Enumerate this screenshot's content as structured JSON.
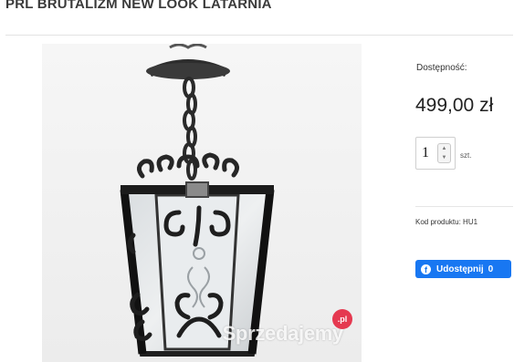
{
  "product": {
    "title": "PRL BRUTALIZM NEW LOOK LATARNIA",
    "image_alt_icon": "lantern-photo"
  },
  "watermark": {
    "text": "Sprzedajemy",
    "badge": ".pl"
  },
  "sidebar": {
    "availability_label": "Dostępność:",
    "price": "499,00 zł",
    "quantity_value": "1",
    "quantity_unit": "szt.",
    "product_code": "Kod produktu:  HU1",
    "share": {
      "icon": "facebook-icon",
      "label": "Udostępnij",
      "count": "0",
      "color": "#1877f2"
    }
  }
}
